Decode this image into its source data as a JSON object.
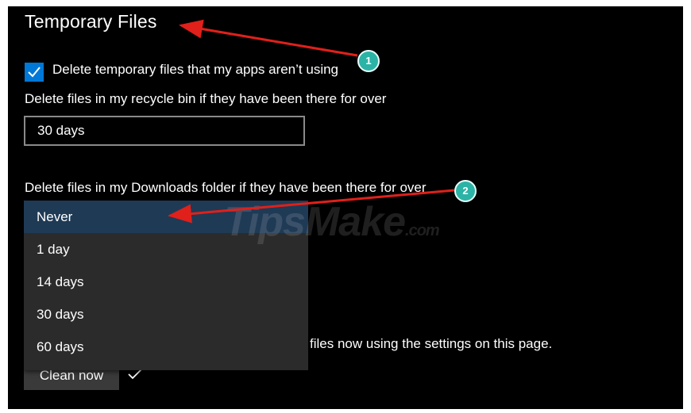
{
  "section": {
    "title": "Temporary Files"
  },
  "temp_files": {
    "checkbox_label": "Delete temporary files that my apps aren’t using",
    "checked": true
  },
  "recycle_bin": {
    "label": "Delete files in my recycle bin if they have been there for over",
    "value": "30 days"
  },
  "downloads": {
    "label": "Delete files in my Downloads folder if they have been there for over",
    "options": [
      "Never",
      "1 day",
      "14 days",
      "30 days",
      "60 days"
    ],
    "selected": "Never"
  },
  "clean": {
    "description": "files now using the settings on this page.",
    "button_label": "Clean now"
  },
  "annotations": {
    "marker_1": "1",
    "marker_2": "2",
    "arrow_color": "#e0201a"
  },
  "watermark": {
    "text": "TipsMake",
    "suffix": ".com"
  },
  "colors": {
    "accent": "#0078d7",
    "background": "#000000",
    "dropdown": "#2b2b2b",
    "selected_option": "#1f3a55"
  }
}
